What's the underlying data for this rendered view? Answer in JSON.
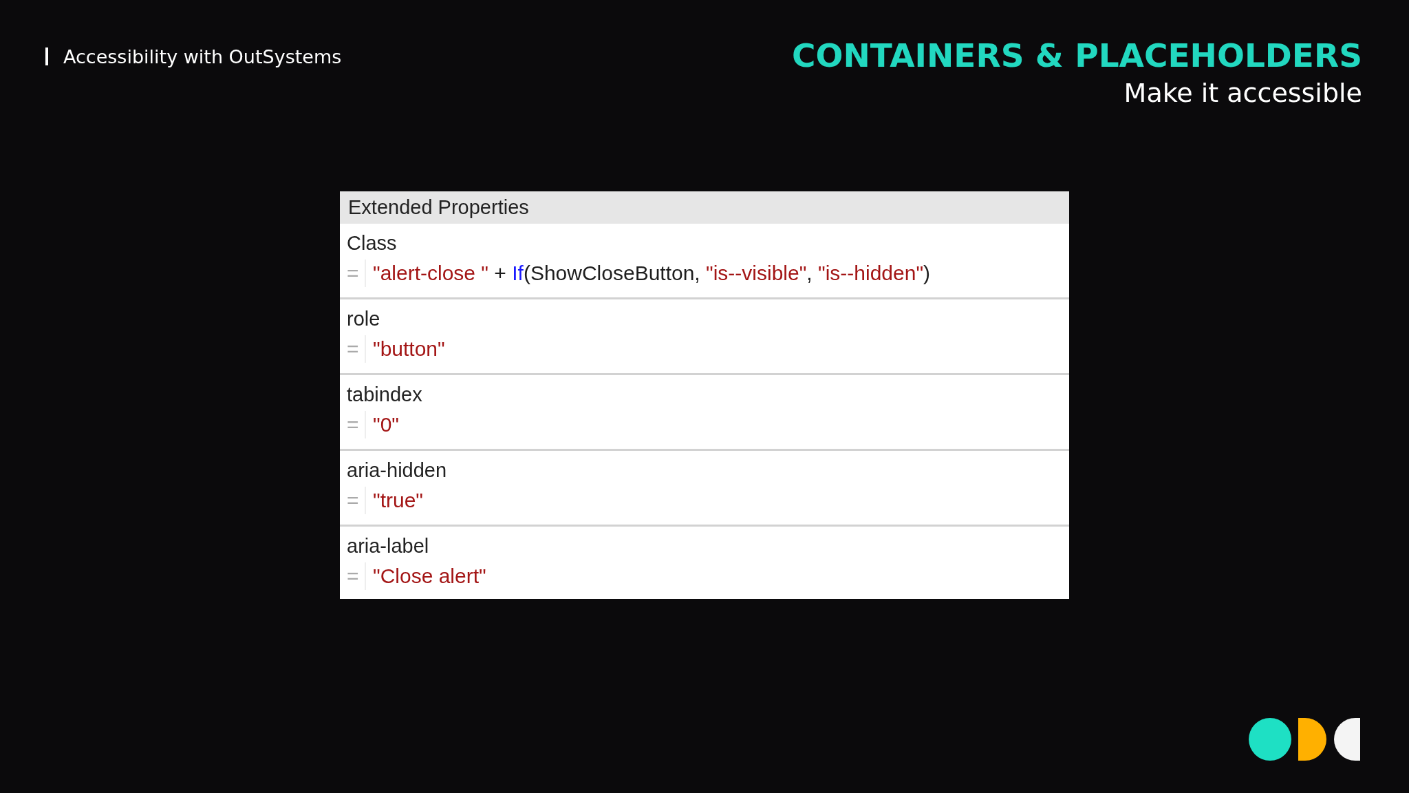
{
  "header": {
    "course": "Accessibility with OutSystems",
    "title": "CONTAINERS & PLACEHOLDERS",
    "subtitle": "Make it accessible"
  },
  "panel": {
    "title": "Extended Properties",
    "properties": [
      {
        "name": "Class",
        "equals": "=",
        "tokens": [
          {
            "text": "\"alert-close \"",
            "kind": "string"
          },
          {
            "text": " + ",
            "kind": "plain"
          },
          {
            "text": "If",
            "kind": "keyword"
          },
          {
            "text": "(ShowCloseButton, ",
            "kind": "plain"
          },
          {
            "text": "\"is--visible\"",
            "kind": "string"
          },
          {
            "text": ", ",
            "kind": "plain"
          },
          {
            "text": "\"is--hidden\"",
            "kind": "string"
          },
          {
            "text": ")",
            "kind": "plain"
          }
        ]
      },
      {
        "name": "role",
        "equals": "=",
        "tokens": [
          {
            "text": "\"button\"",
            "kind": "string"
          }
        ]
      },
      {
        "name": "tabindex",
        "equals": "=",
        "tokens": [
          {
            "text": "\"0\"",
            "kind": "string"
          }
        ]
      },
      {
        "name": "aria-hidden",
        "equals": "=",
        "tokens": [
          {
            "text": "\"true\"",
            "kind": "string"
          }
        ]
      },
      {
        "name": "aria-label",
        "equals": "=",
        "tokens": [
          {
            "text": "\"Close alert\"",
            "kind": "string"
          }
        ]
      }
    ]
  }
}
